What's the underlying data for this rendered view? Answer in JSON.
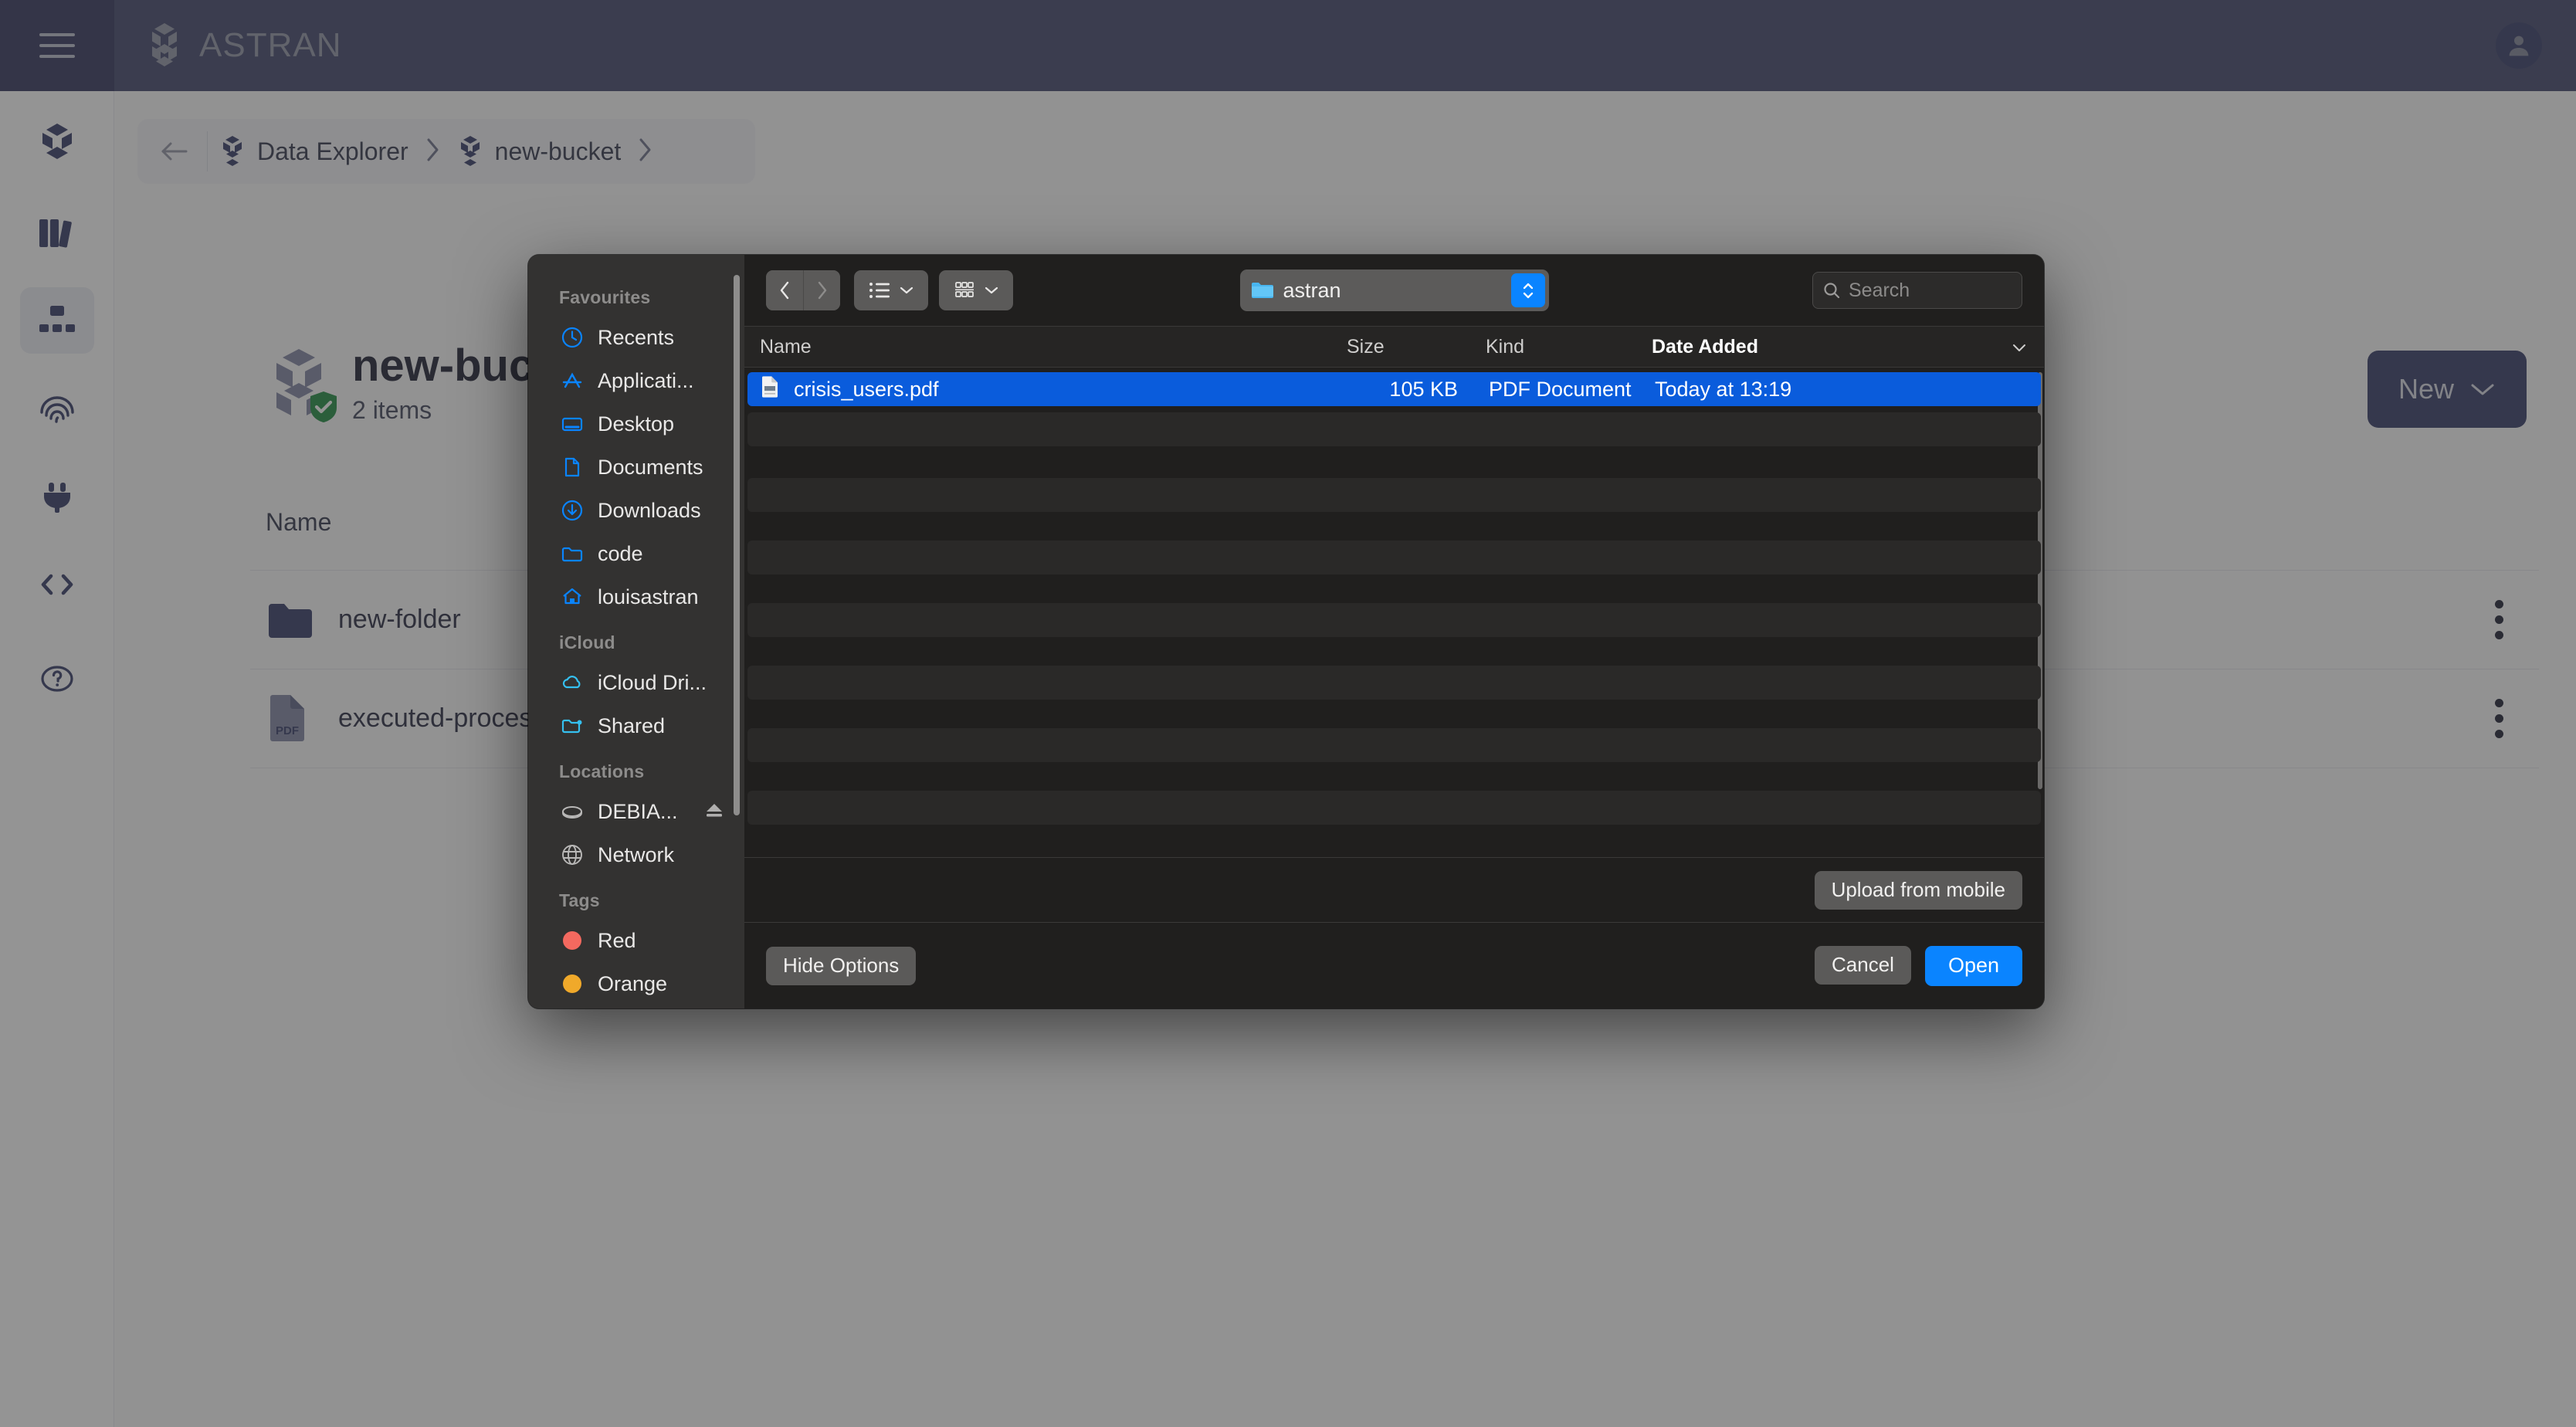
{
  "topbar": {
    "brand_name": "ASTRAN",
    "menu_icon": "hamburger-icon",
    "avatar_icon": "user-avatar-icon"
  },
  "left_rail": {
    "items": [
      {
        "name": "data-explorer",
        "icon": "cube-icon",
        "active": false
      },
      {
        "name": "library",
        "icon": "books-icon",
        "active": false
      },
      {
        "name": "topology",
        "icon": "sitemap-icon",
        "active": true
      },
      {
        "name": "identity",
        "icon": "fingerprint-icon",
        "active": false
      },
      {
        "name": "integrations",
        "icon": "plug-icon",
        "active": false
      },
      {
        "name": "developers",
        "icon": "code-brackets-icon",
        "active": false
      },
      {
        "name": "help",
        "icon": "question-circle-icon",
        "active": false
      }
    ]
  },
  "breadcrumb": {
    "back_icon": "arrow-left-icon",
    "items": [
      {
        "label": "Data Explorer",
        "icon": "astran-hex-icon"
      },
      {
        "label": "new-bucket",
        "icon": "astran-hex-icon"
      }
    ]
  },
  "bucket": {
    "title": "new-bucket",
    "subtitle": "2 items",
    "icon": "bucket-hex-icon",
    "badge_icon": "shield-check-icon"
  },
  "new_button": {
    "label": "New",
    "chevron_icon": "chevron-down-icon"
  },
  "file_table": {
    "columns": [
      "Name"
    ],
    "rows": [
      {
        "name": "new-folder",
        "icon": "folder-icon",
        "menu_icon": "kebab-menu-icon"
      },
      {
        "name": "executed-processes_louis_as",
        "icon": "pdf-file-icon",
        "menu_icon": "kebab-menu-icon"
      }
    ]
  },
  "dialog": {
    "sidebar": {
      "sections": [
        {
          "title": "Favourites",
          "items": [
            {
              "label": "Recents",
              "icon": "clock-icon"
            },
            {
              "label": "Applicati...",
              "icon": "applications-icon"
            },
            {
              "label": "Desktop",
              "icon": "desktop-icon"
            },
            {
              "label": "Documents",
              "icon": "document-icon"
            },
            {
              "label": "Downloads",
              "icon": "download-icon"
            },
            {
              "label": "code",
              "icon": "folder-icon"
            },
            {
              "label": "louisastran",
              "icon": "home-icon"
            }
          ]
        },
        {
          "title": "iCloud",
          "items": [
            {
              "label": "iCloud Dri...",
              "icon": "cloud-icon"
            },
            {
              "label": "Shared",
              "icon": "shared-folder-icon"
            }
          ]
        },
        {
          "title": "Locations",
          "items": [
            {
              "label": "DEBIA...",
              "icon": "disk-icon",
              "trailing_icon": "eject-icon"
            },
            {
              "label": "Network",
              "icon": "globe-icon"
            }
          ]
        },
        {
          "title": "Tags",
          "items": [
            {
              "label": "Red",
              "icon": "tag-dot-icon",
              "color": "#f4695f"
            },
            {
              "label": "Orange",
              "icon": "tag-dot-icon",
              "color": "#f0a92a"
            }
          ]
        }
      ]
    },
    "toolbar": {
      "back_icon": "chevron-left-icon",
      "forward_icon": "chevron-right-icon",
      "list_view_icon": "list-view-icon",
      "group_view_icon": "group-view-icon",
      "view_chevron_icon": "chevron-down-icon",
      "path_label": "astran",
      "path_icon": "folder-icon",
      "path_stepper_icon": "up-down-stepper-icon",
      "search_placeholder": "Search",
      "search_icon": "search-icon",
      "search_value": ""
    },
    "columns": [
      {
        "key": "name",
        "label": "Name"
      },
      {
        "key": "size",
        "label": "Size"
      },
      {
        "key": "kind",
        "label": "Kind"
      },
      {
        "key": "date",
        "label": "Date Added",
        "sorted": true,
        "sort_icon": "chevron-down-icon"
      }
    ],
    "files": [
      {
        "name": "crisis_users.pdf",
        "size": "105 KB",
        "kind": "PDF Document",
        "date": "Today at 13:19",
        "icon": "pdf-document-icon",
        "selected": true
      }
    ],
    "empty_row_count": 7,
    "upload_button": {
      "label": "Upload from mobile"
    },
    "hide_options_button": {
      "label": "Hide Options"
    },
    "cancel_button": {
      "label": "Cancel"
    },
    "open_button": {
      "label": "Open"
    }
  },
  "colors": {
    "brand_navy": "#2e3362",
    "topbar": "#3a3f66",
    "accent_blue": "#0a84ff",
    "selection_blue": "#0a5cdc",
    "dialog_bg": "#201f1e",
    "dialog_sidebar_bg": "#333231"
  }
}
